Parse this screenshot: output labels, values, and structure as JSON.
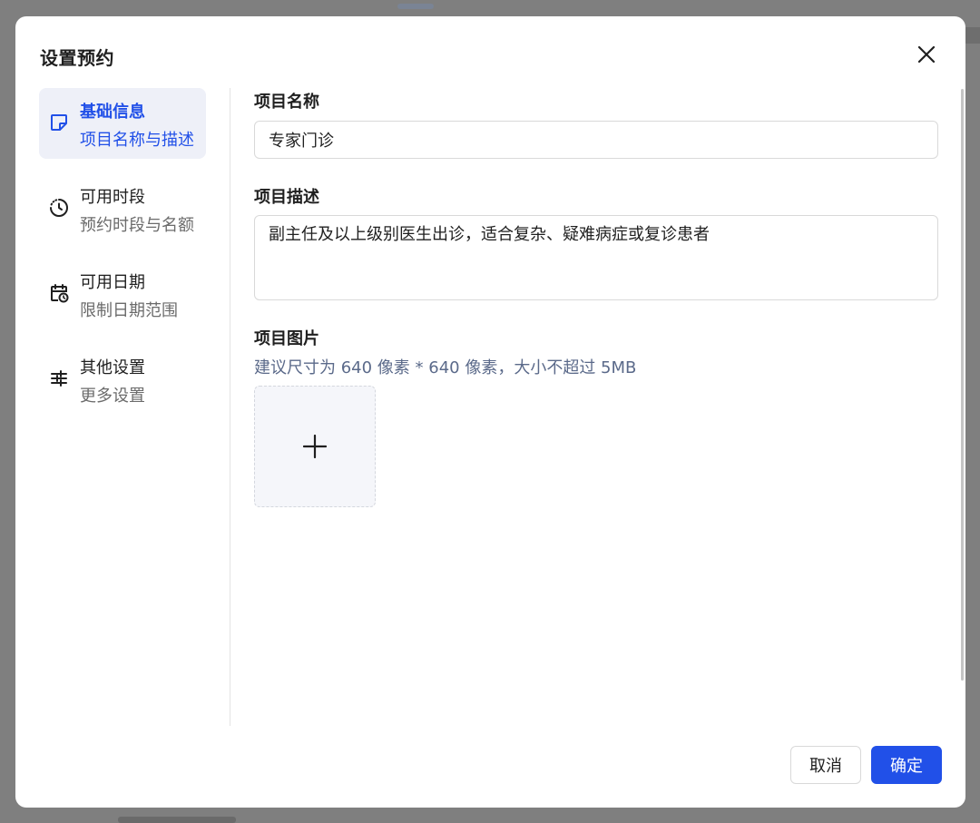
{
  "dialog": {
    "title": "设置预约",
    "close_icon": "close-icon"
  },
  "nav": {
    "items": [
      {
        "title": "基础信息",
        "subtitle": "项目名称与描述",
        "icon": "note-icon",
        "active": true
      },
      {
        "title": "可用时段",
        "subtitle": "预约时段与名额",
        "icon": "clock-icon",
        "active": false
      },
      {
        "title": "可用日期",
        "subtitle": "限制日期范围",
        "icon": "calendar-clock-icon",
        "active": false
      },
      {
        "title": "其他设置",
        "subtitle": "更多设置",
        "icon": "sliders-icon",
        "active": false
      }
    ]
  },
  "form": {
    "name": {
      "label": "项目名称",
      "value": "专家门诊"
    },
    "description": {
      "label": "项目描述",
      "value": "副主任及以上级别医生出诊，适合复杂、疑难病症或复诊患者"
    },
    "image": {
      "label": "项目图片",
      "hint": "建议尺寸为 640 像素 * 640 像素，大小不超过 5MB",
      "upload_icon": "plus-icon"
    }
  },
  "footer": {
    "cancel_label": "取消",
    "confirm_label": "确定"
  },
  "colors": {
    "accent": "#2150e8",
    "active_nav_bg": "#eef0f8",
    "overlay": "#7f7f7f"
  }
}
